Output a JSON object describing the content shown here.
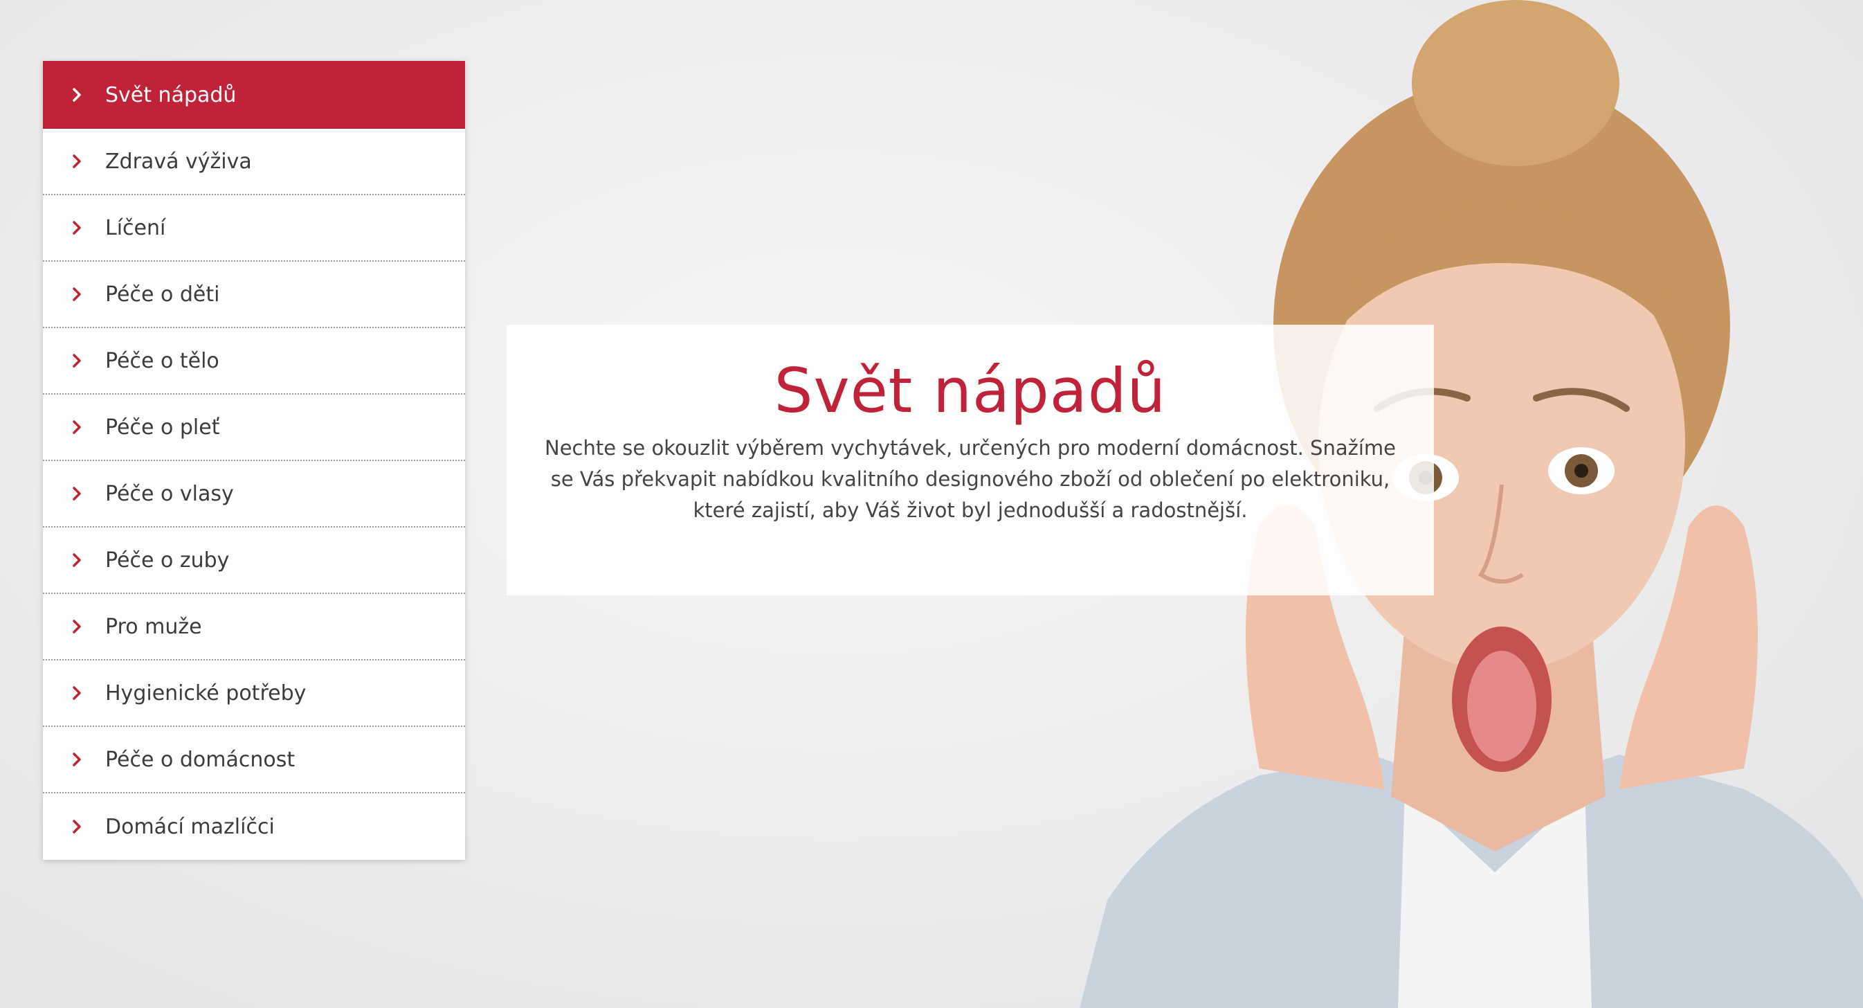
{
  "colors": {
    "accent": "#c0223a",
    "menu_text": "#3c3c3c",
    "body_text": "#444444"
  },
  "sidebar": {
    "active_index": 0,
    "items": [
      {
        "label": "Svět nápadů"
      },
      {
        "label": "Zdravá výživa"
      },
      {
        "label": "Líčení"
      },
      {
        "label": "Péče o děti"
      },
      {
        "label": "Péče o tělo"
      },
      {
        "label": "Péče o pleť"
      },
      {
        "label": "Péče o vlasy"
      },
      {
        "label": "Péče o zuby"
      },
      {
        "label": "Pro muže"
      },
      {
        "label": "Hygienické potřeby"
      },
      {
        "label": "Péče o domácnost"
      },
      {
        "label": "Domácí mazlíčci"
      }
    ],
    "item_icon": "chevron-right-icon"
  },
  "intro": {
    "title": "Svět nápadů",
    "text": "Nechte se okouzlit výběrem vychytávek, určených pro moderní domácnost. Snažíme se Vás překvapit nabídkou kvalitního designového zboží od oblečení po elektroniku, které zajistí, aby Váš život byl jednodušší a radostnější."
  },
  "hero": {
    "image": "surprised-woman-photo"
  }
}
